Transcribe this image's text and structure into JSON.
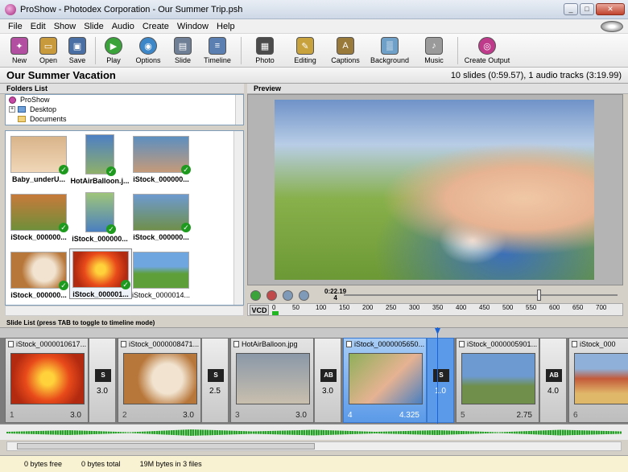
{
  "window": {
    "title": "ProShow - Photodex Corporation - Our Summer Trip.psh"
  },
  "menu": [
    "File",
    "Edit",
    "Show",
    "Slide",
    "Audio",
    "Create",
    "Window",
    "Help"
  ],
  "toolbar": [
    {
      "label": "New",
      "icon": "new-icon",
      "color": "#b34fa0"
    },
    {
      "label": "Open",
      "icon": "open-icon",
      "color": "#c89a3c"
    },
    {
      "label": "Save",
      "icon": "save-icon",
      "color": "#4a6fa5"
    },
    {
      "label": "Play",
      "icon": "play-icon",
      "color": "#3aa33a"
    },
    {
      "label": "Options",
      "icon": "options-icon",
      "color": "#3d87c9"
    },
    {
      "label": "Slide",
      "icon": "slide-icon",
      "color": "#6f7f96"
    },
    {
      "label": "Timeline",
      "icon": "timeline-icon",
      "color": "#5a7fb0"
    },
    {
      "label": "Photo",
      "icon": "photo-icon",
      "color": "#4b4b4b"
    },
    {
      "label": "Editing",
      "icon": "editing-icon",
      "color": "#c8a23c"
    },
    {
      "label": "Captions",
      "icon": "captions-icon",
      "color": "#9a7a3a"
    },
    {
      "label": "Background",
      "icon": "background-icon",
      "color": "#6fa0c8"
    },
    {
      "label": "Music",
      "icon": "music-icon",
      "color": "#9a9a9a"
    },
    {
      "label": "Create Output",
      "icon": "create-output-icon",
      "color": "#c03a8c"
    }
  ],
  "show": {
    "title": "Our Summer Vacation",
    "info": "10 slides (0:59.57), 1 audio tracks (3:19.99)"
  },
  "folders": {
    "header": "Folders List",
    "items": [
      "ProShow",
      "Desktop",
      "Documents"
    ]
  },
  "thumbnails": [
    {
      "caption": "Baby_underU...",
      "checked": true
    },
    {
      "caption": "HotAirBalloon.j...",
      "checked": true
    },
    {
      "caption": "iStock_000000...",
      "checked": true
    },
    {
      "caption": "iStock_000000...",
      "checked": true
    },
    {
      "caption": "iStock_000000...",
      "checked": true
    },
    {
      "caption": "iStock_000000...",
      "checked": true
    },
    {
      "caption": "iStock_000000...",
      "checked": true
    },
    {
      "caption": "iStock_000001...",
      "checked": true
    },
    {
      "caption": "iStock_0000014...",
      "checked": false
    }
  ],
  "preview": {
    "header": "Preview",
    "time": "0:22.19",
    "frame": "4",
    "ruler_label": "VCD",
    "ticks": [
      "0",
      "50",
      "100",
      "150",
      "200",
      "250",
      "300",
      "350",
      "400",
      "450",
      "500",
      "550",
      "600",
      "650",
      "700"
    ]
  },
  "slide_list": {
    "header": "Slide List (press TAB to toggle to timeline mode)",
    "slides": [
      {
        "name": "iStock_0000010617...",
        "index": "1",
        "duration": "3.0"
      },
      {
        "name": "iStock_0000008471...",
        "index": "2",
        "duration": "3.0"
      },
      {
        "name": "HotAirBalloon.jpg",
        "index": "3",
        "duration": "3.0"
      },
      {
        "name": "iStock_0000005650...",
        "index": "4",
        "duration": "4.325"
      },
      {
        "name": "iStock_0000005901...",
        "index": "5",
        "duration": "2.75"
      },
      {
        "name": "iStock_000",
        "index": "6",
        "duration": ""
      }
    ],
    "transitions": [
      {
        "label": "S",
        "duration": "3.0"
      },
      {
        "label": "S",
        "duration": "2.5"
      },
      {
        "label": "AB",
        "duration": "3.0"
      },
      {
        "label": "S",
        "duration": "1.0"
      },
      {
        "label": "AB",
        "duration": "4.0"
      }
    ]
  },
  "status": {
    "free": "0 bytes free",
    "total": "0 bytes total",
    "files": "19M bytes in   3 files"
  }
}
